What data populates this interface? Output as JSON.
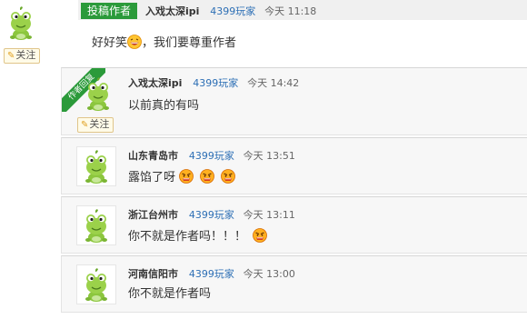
{
  "main_post": {
    "follow_label": "关注",
    "badge": "投稿作者",
    "username": "入戏太深ipi",
    "tag": "4399玩家",
    "time": "今天 11:18",
    "content_before": "好好笑",
    "content_after": "，我们要尊重作者"
  },
  "replies": [
    {
      "ribbon": "作者回复",
      "follow_label": "关注",
      "username": "入戏太深ipi",
      "tag": "4399玩家",
      "time": "今天 14:42",
      "content": "以前真的有吗"
    },
    {
      "username": "山东青岛市",
      "tag": "4399玩家",
      "time": "今天 13:51",
      "content": "露馅了呀"
    },
    {
      "username": "浙江台州市",
      "tag": "4399玩家",
      "time": "今天 13:11",
      "content": "你不就是作者吗！！！"
    },
    {
      "username": "河南信阳市",
      "tag": "4399玩家",
      "time": "今天 13:00",
      "content": "你不就是作者吗"
    }
  ],
  "colors": {
    "author_green": "#2b9a3a",
    "tag_blue": "#2d6fb5",
    "card_bg": "#f7f7f7"
  },
  "icons": [
    "frog-avatar-icon",
    "laughing-emoji-icon",
    "angry-emoji-icon",
    "pencil-icon"
  ]
}
